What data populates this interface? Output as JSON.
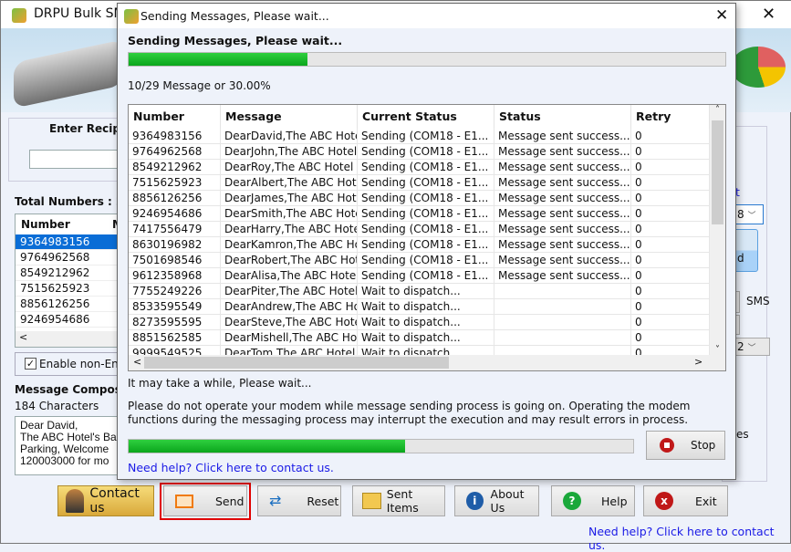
{
  "main": {
    "title": "DRPU Bulk SMS (Mu",
    "enter_recipient": "Enter Recip",
    "total_numbers": "Total Numbers : 2",
    "numbers_header": "Number",
    "numbers_header2": "M",
    "numbers": [
      "9364983156",
      "9764962568",
      "8549212962",
      "7515625923",
      "8856126256",
      "9246954686"
    ],
    "enable_non_english": "Enable non-Eng",
    "enable_checked": true,
    "message_composer": "Message Compos",
    "characters": "184 Characters",
    "message_lines": [
      "Dear David,",
      "The ABC Hotel's Ba",
      "Parking, Welcome",
      "120003000 for mo"
    ],
    "right_link": "t",
    "right_select": "8",
    "right_button": "d",
    "sms_label": "SMS",
    "right_select2": "2",
    "right_text": "es",
    "buttons": {
      "contact": "Contact us",
      "send": "Send",
      "reset": "Reset",
      "sent_items": "Sent Items",
      "about": "About Us",
      "help": "Help",
      "exit": "Exit"
    },
    "help_link": "Need help? Click here to contact us."
  },
  "dialog": {
    "title": "Sending Messages, Please wait...",
    "heading": "Sending Messages, Please wait...",
    "progress_percent": 30,
    "progress_text": "10/29 Message or",
    "progress_pct_text": "30.00%",
    "columns": [
      "Number",
      "Message",
      "Current Status",
      "Status",
      "Retry"
    ],
    "rows": [
      [
        "9364983156",
        "DearDavid,The ABC Hotel",
        "Sending (COM18 - E1...",
        "Message sent success...",
        "0"
      ],
      [
        "9764962568",
        "DearJohn,The ABC Hotel",
        "Sending (COM18 - E1...",
        "Message sent success...",
        "0"
      ],
      [
        "8549212962",
        "DearRoy,The ABC Hotel B",
        "Sending (COM18 - E1...",
        "Message sent success...",
        "0"
      ],
      [
        "7515625923",
        "DearAlbert,The ABC Hotel",
        "Sending (COM18 - E1...",
        "Message sent success...",
        "0"
      ],
      [
        "8856126256",
        "DearJames,The ABC Hotel",
        "Sending (COM18 - E1...",
        "Message sent success...",
        "0"
      ],
      [
        "9246954686",
        "DearSmith,The ABC Hotel",
        "Sending (COM18 - E1...",
        "Message sent success...",
        "0"
      ],
      [
        "7417556479",
        "DearHarry,The ABC Hotel",
        "Sending (COM18 - E1...",
        "Message sent success...",
        "0"
      ],
      [
        "8630196982",
        "DearKamron,The ABC Hotel",
        "Sending (COM18 - E1...",
        "Message sent success...",
        "0"
      ],
      [
        "7501698546",
        "DearRobert,The ABC Hotel",
        "Sending (COM18 - E1...",
        "Message sent success...",
        "0"
      ],
      [
        "9612358968",
        "DearAlisa,The ABC Hotel",
        "Sending (COM18 - E1...",
        "Message sent success...",
        "0"
      ],
      [
        "7755249226",
        "DearPiter,The ABC Hotel B",
        "Wait to dispatch...",
        "",
        "0"
      ],
      [
        "8533595549",
        "DearAndrew,The ABC Hotel",
        "Wait to dispatch...",
        "",
        "0"
      ],
      [
        "8273595595",
        "DearSteve,The ABC Hotel",
        "Wait to dispatch...",
        "",
        "0"
      ],
      [
        "8851562585",
        "DearMishell,The ABC Hotel",
        "Wait to dispatch...",
        "",
        "0"
      ],
      [
        "9999549525",
        "DearTom,The ABC Hotel",
        "Wait to dispatch...",
        "",
        "0"
      ]
    ],
    "wait_text": "It may take a while, Please wait...",
    "warning": "Please do not operate your modem while message sending process is going on. Operating the modem functions during the messaging process may interrupt the execution and may result errors in process.",
    "stop": "Stop",
    "help_link": "Need help? Click here to contact us."
  },
  "colors": {
    "progress": "#0aa61c",
    "selection": "#0a6dd6",
    "link": "#1a1ae6",
    "send_highlight": "#e00000"
  }
}
